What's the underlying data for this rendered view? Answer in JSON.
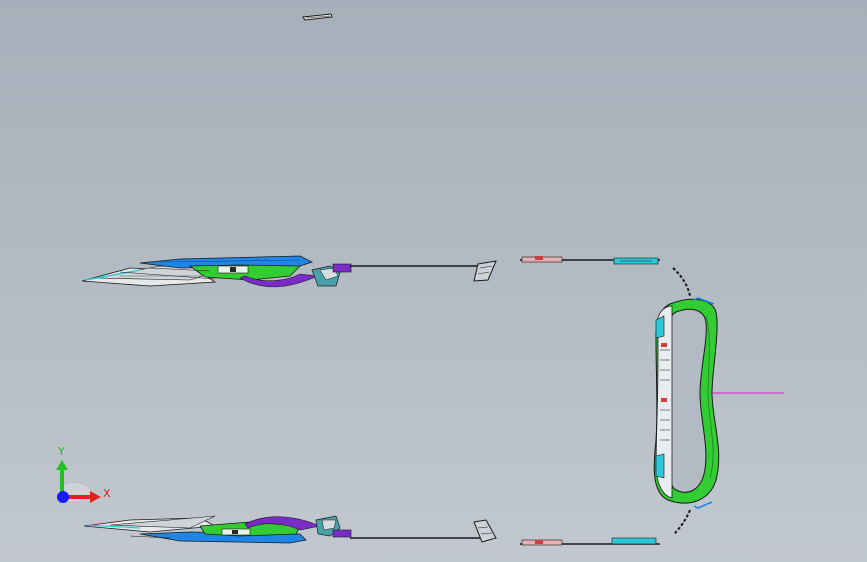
{
  "app": {
    "title": ""
  },
  "triad": {
    "x_label": "X",
    "y_label": "Y",
    "x_color": "#e02020",
    "y_color": "#22c022",
    "z_color": "#1a1aff"
  },
  "colors": {
    "background_top": "#a7b0ba",
    "background_bottom": "#c2c8cf",
    "part_blue": "#1f86e8",
    "part_green": "#33cc33",
    "part_purple": "#7a2cc8",
    "part_cyan": "#28c8d8",
    "part_red": "#d04040",
    "edge": "#1a1a1a",
    "sketch_line": "#d020d0"
  },
  "parts": [
    {
      "name": "top-small-bracket"
    },
    {
      "name": "upper-side-assembly"
    },
    {
      "name": "lower-side-assembly"
    },
    {
      "name": "upper-clip"
    },
    {
      "name": "lower-clip"
    },
    {
      "name": "upper-rail"
    },
    {
      "name": "lower-rail"
    },
    {
      "name": "front-ring-assembly"
    }
  ]
}
